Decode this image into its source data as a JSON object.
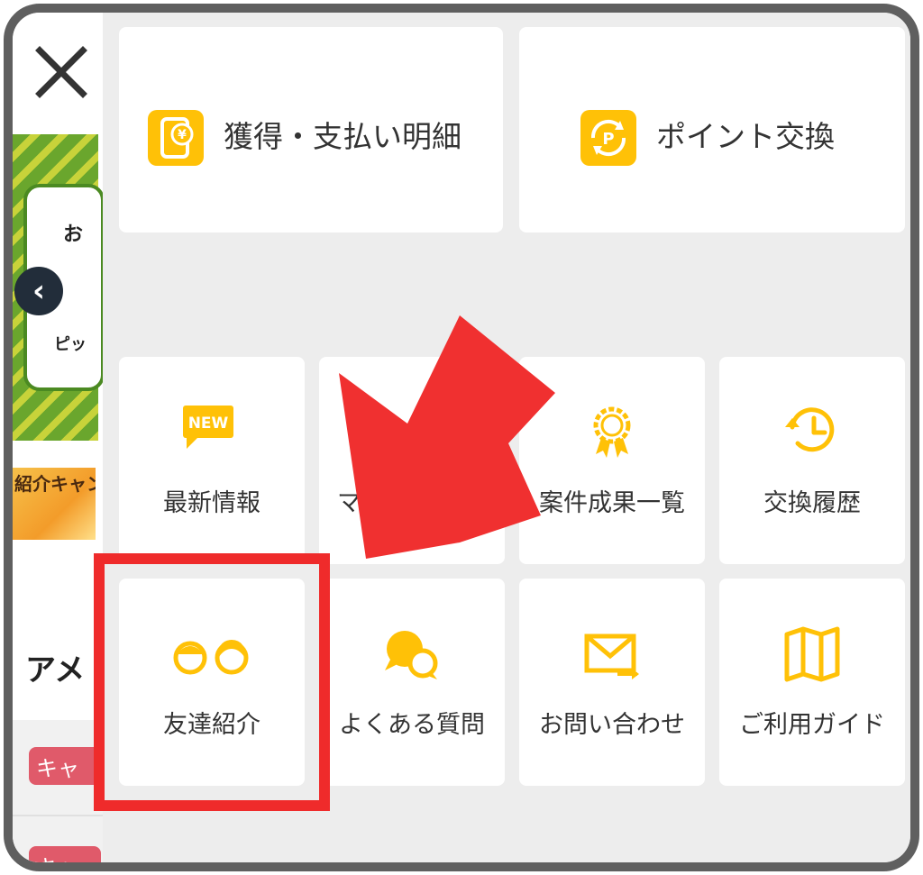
{
  "colors": {
    "accent": "#ffc107",
    "highlight": "#ef2b2b",
    "arrow": "#f03030",
    "text": "#333333"
  },
  "background": {
    "banner_text_1": "お",
    "banner_text_2": "ピッ",
    "promo_text": "紹介キャン",
    "heading_partial": "アメ",
    "tag_1": "キャ",
    "tag_2": "キャ"
  },
  "menu": {
    "top_cards": [
      {
        "label": "獲得・支払い明細",
        "icon": "yen-wallet-icon"
      },
      {
        "label": "ポイント交換",
        "icon": "point-exchange-icon"
      }
    ],
    "grid": [
      {
        "label": "最新情報",
        "icon": "new-badge-icon"
      },
      {
        "label": "マ",
        "icon": "hidden-icon"
      },
      {
        "label": "案件成果一覧",
        "icon": "award-ribbon-icon"
      },
      {
        "label": "交換履歴",
        "icon": "history-clock-icon"
      },
      {
        "label": "友達紹介",
        "icon": "two-friends-icon"
      },
      {
        "label": "よくある質問",
        "icon": "faq-chat-icon"
      },
      {
        "label": "お問い合わせ",
        "icon": "mail-send-icon"
      },
      {
        "label": "ご利用ガイド",
        "icon": "guide-map-icon"
      }
    ]
  }
}
